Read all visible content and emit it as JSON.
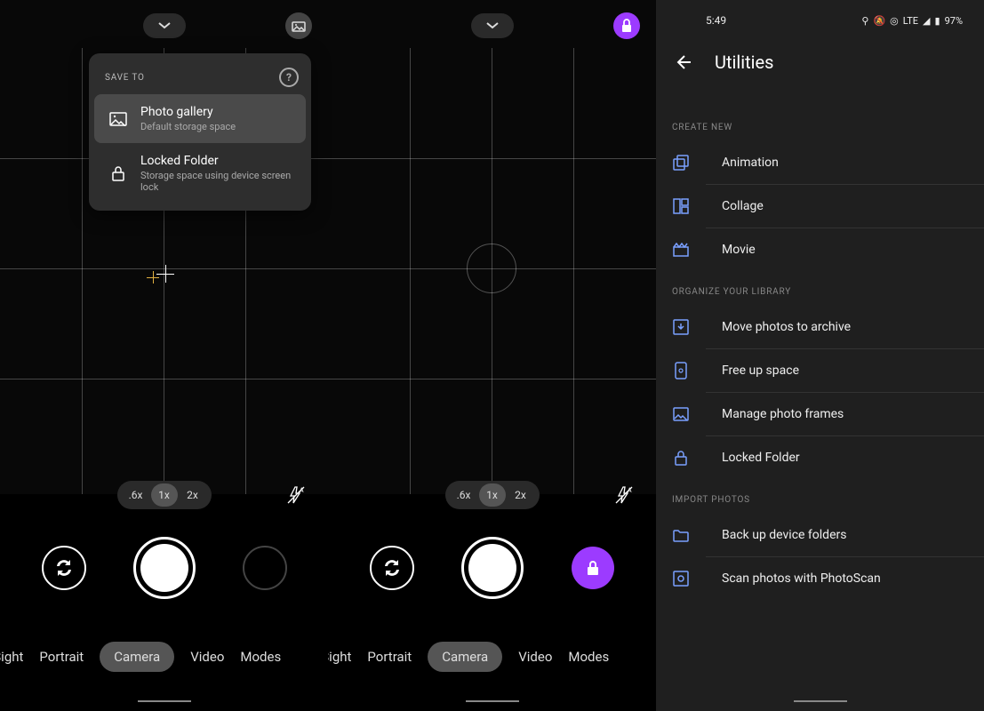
{
  "panel1": {
    "popup": {
      "header": "SAVE TO",
      "items": [
        {
          "title": "Photo gallery",
          "sub": "Default storage space"
        },
        {
          "title": "Locked Folder",
          "sub": "Storage space using device screen lock"
        }
      ]
    },
    "zoom": {
      "z1": ".6x",
      "z2": "1x",
      "z3": "2x"
    },
    "modes": {
      "m0": "it Sight",
      "m1": "Portrait",
      "m2": "Camera",
      "m3": "Video",
      "m4": "Modes"
    }
  },
  "panel2": {
    "zoom": {
      "z1": ".6x",
      "z2": "1x",
      "z3": "2x"
    },
    "modes": {
      "m0": "it Sight",
      "m1": "Portrait",
      "m2": "Camera",
      "m3": "Video",
      "m4": "Modes"
    }
  },
  "utilities": {
    "time": "5:49",
    "status": {
      "net": "LTE",
      "battery": "97%"
    },
    "title": "Utilities",
    "sections": {
      "s1": "CREATE NEW",
      "s2": "ORGANIZE YOUR LIBRARY",
      "s3": "IMPORT PHOTOS"
    },
    "items": {
      "animation": "Animation",
      "collage": "Collage",
      "movie": "Movie",
      "archive": "Move photos to archive",
      "freeup": "Free up space",
      "frames": "Manage photo frames",
      "locked": "Locked Folder",
      "backup": "Back up device folders",
      "photoscan": "Scan photos with PhotoScan"
    }
  }
}
